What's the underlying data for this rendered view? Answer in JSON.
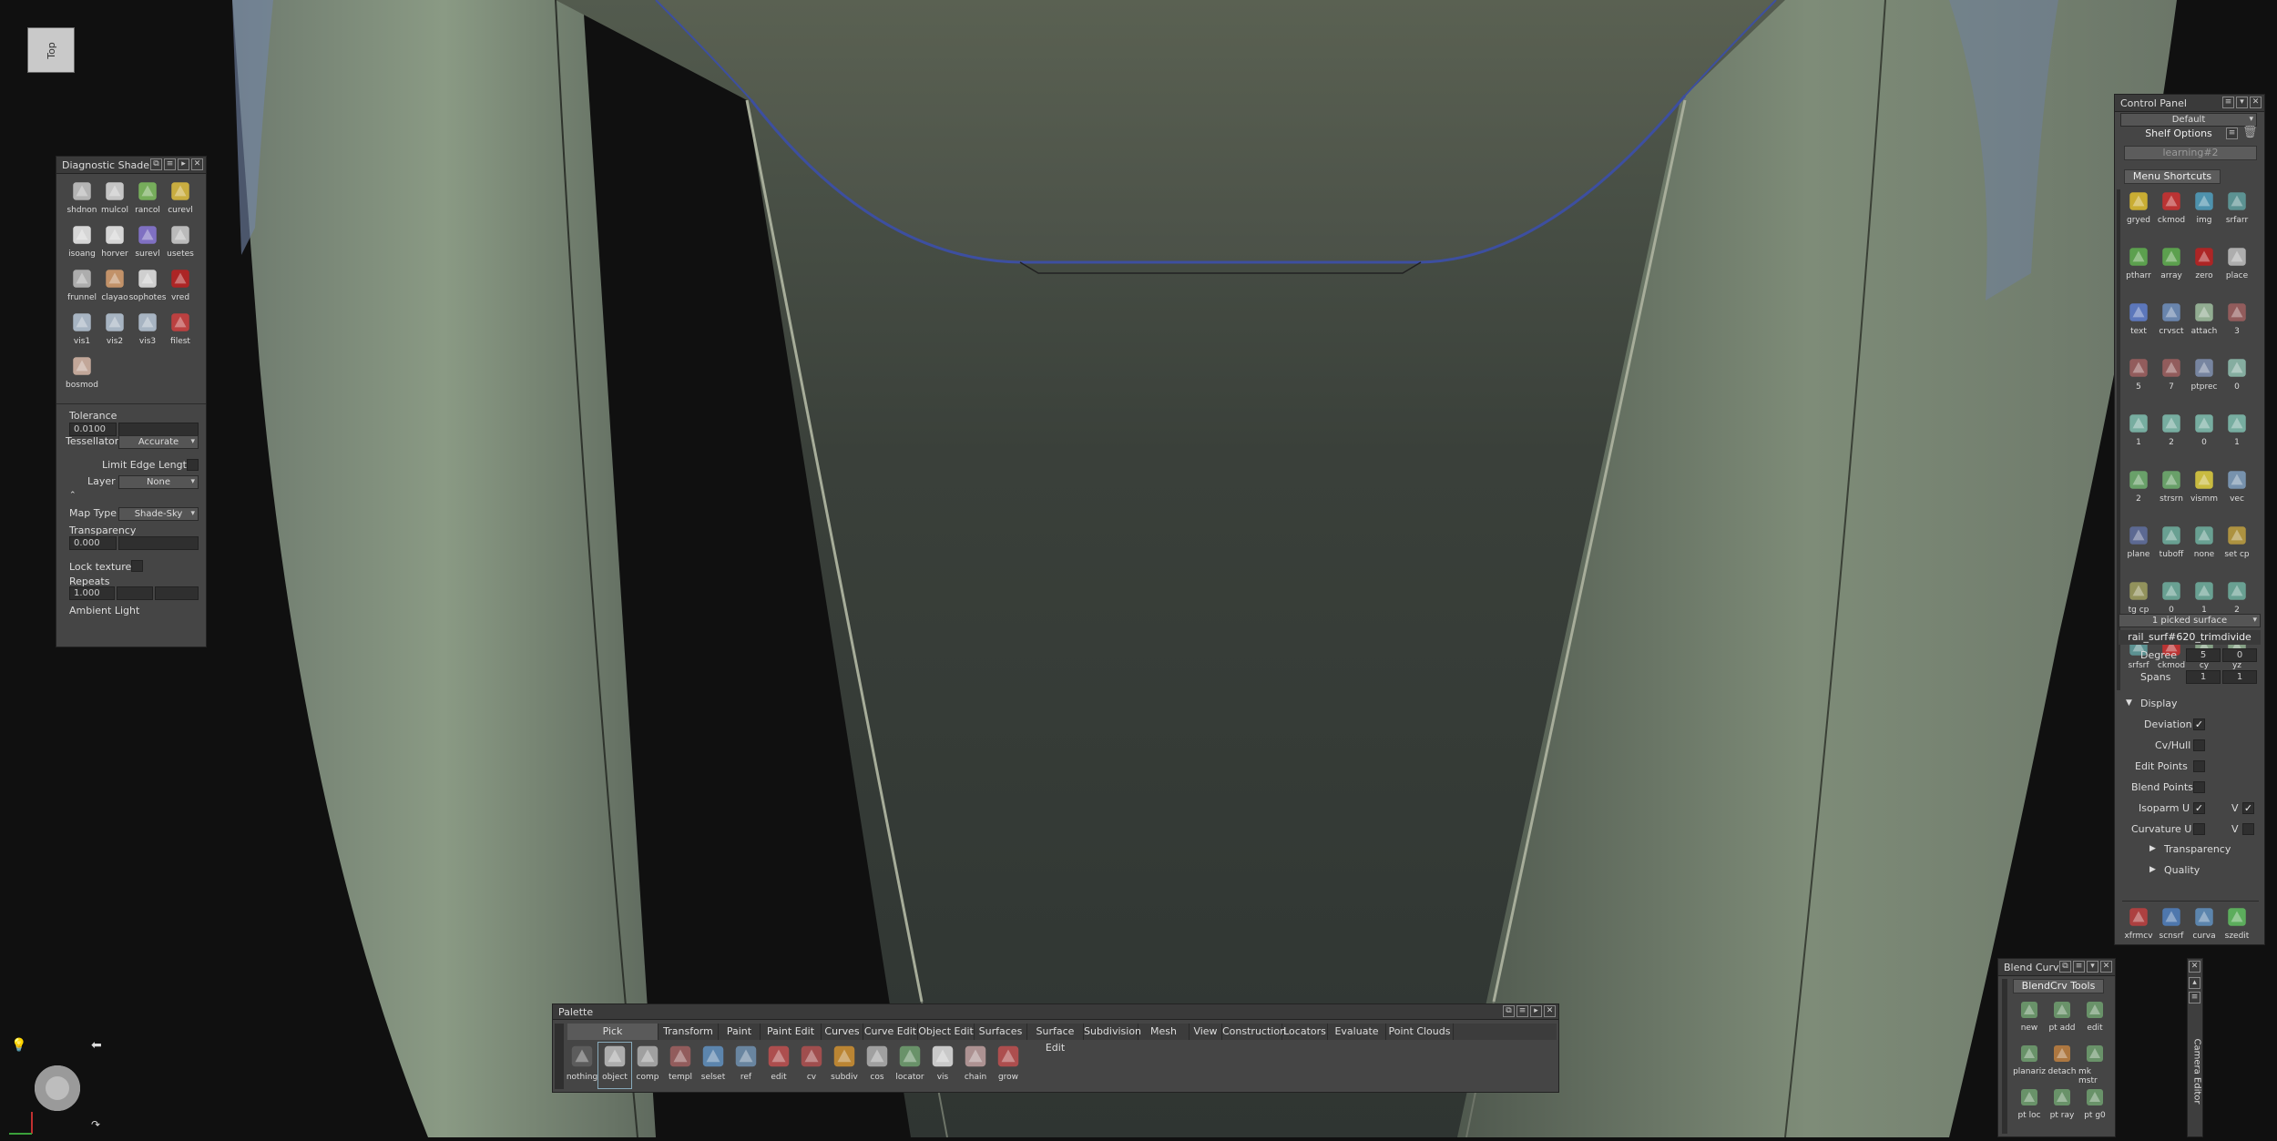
{
  "viewport": {
    "view_label": "Top"
  },
  "diagnostic_shade": {
    "title": "Diagnostic Shade",
    "tools": [
      {
        "label": "shdnon",
        "color": "#c8c8c8"
      },
      {
        "label": "mulcol",
        "color": "#dcdcdc"
      },
      {
        "label": "rancol",
        "color": "#7fbf5f"
      },
      {
        "label": "curevl",
        "color": "#e0c040"
      },
      {
        "label": "isoang",
        "color": "#f0f0f0"
      },
      {
        "label": "horver",
        "color": "#f0f0f0"
      },
      {
        "label": "surevl",
        "color": "#8a78d8"
      },
      {
        "label": "usetes",
        "color": "#cfcfcf"
      },
      {
        "label": "frunnel",
        "color": "#c0c0c0"
      },
      {
        "label": "clayao",
        "color": "#d8a070"
      },
      {
        "label": "sophotes",
        "color": "#e8e8e8"
      },
      {
        "label": "vred",
        "color": "#c02020"
      },
      {
        "label": "vis1",
        "color": "#b8c8d8"
      },
      {
        "label": "vis2",
        "color": "#b8c8d8"
      },
      {
        "label": "vis3",
        "color": "#b8c8d8"
      },
      {
        "label": "filest",
        "color": "#d04040"
      },
      {
        "label": "bosmod",
        "color": "#d8b8a8"
      }
    ],
    "tolerance_label": "Tolerance",
    "tolerance_value": "0.0100",
    "tessellator_label": "Tessellator",
    "tessellator_value": "Accurate",
    "limit_edge_label": "Limit Edge Length",
    "layer_label": "Layer",
    "layer_value": "None",
    "map_type_label": "Map Type",
    "map_type_value": "Shade-Sky",
    "transparency_label": "Transparency",
    "transparency_value": "0.000",
    "lock_texture_label": "Lock texture",
    "repeats_label": "Repeats",
    "repeats_value": "1.000",
    "ambient_label": "Ambient Light"
  },
  "control_panel": {
    "title": "Control Panel",
    "preset": "Default",
    "shelf_options": "Shelf Options",
    "shelf_name": "learning#2",
    "menu_shortcuts": "Menu Shortcuts",
    "shortcuts": [
      {
        "label": "gryed",
        "color": "#e0c030"
      },
      {
        "label": "ckmod",
        "color": "#d03030"
      },
      {
        "label": "img",
        "color": "#50a0c0"
      },
      {
        "label": "srfarr",
        "color": "#60a0a0"
      },
      {
        "label": "ptharr",
        "color": "#60b050"
      },
      {
        "label": "array",
        "color": "#60b050"
      },
      {
        "label": "zero",
        "color": "#c02020"
      },
      {
        "label": "place",
        "color": "#c0c0c0"
      },
      {
        "label": "text",
        "color": "#6080d0"
      },
      {
        "label": "crvsct",
        "color": "#7090c0"
      },
      {
        "label": "attach",
        "color": "#a0c0a0"
      },
      {
        "label": "3",
        "color": "#a06060"
      },
      {
        "label": "5",
        "color": "#a06060"
      },
      {
        "label": "7",
        "color": "#a06060"
      },
      {
        "label": "ptprec",
        "color": "#8090b0"
      },
      {
        "label": "0",
        "color": "#90c0b0"
      },
      {
        "label": "1",
        "color": "#80c0b0"
      },
      {
        "label": "2",
        "color": "#80c0b0"
      },
      {
        "label": "0",
        "color": "#80c0b0"
      },
      {
        "label": "1",
        "color": "#80c0b0"
      },
      {
        "label": "2",
        "color": "#70b070"
      },
      {
        "label": "strsrn",
        "color": "#70b070"
      },
      {
        "label": "vismm",
        "color": "#e0d040"
      },
      {
        "label": "vec",
        "color": "#80a0c0"
      },
      {
        "label": "plane",
        "color": "#6070a0"
      },
      {
        "label": "tuboff",
        "color": "#70b0a0"
      },
      {
        "label": "none",
        "color": "#70b0a0"
      },
      {
        "label": "set cp",
        "color": "#c0a040"
      },
      {
        "label": "tg cp",
        "color": "#a0a060"
      },
      {
        "label": "0",
        "color": "#70b0a0"
      },
      {
        "label": "1",
        "color": "#70b0a0"
      },
      {
        "label": "2",
        "color": "#70b0a0"
      },
      {
        "label": "srfsrf",
        "color": "#60a0a0"
      },
      {
        "label": "ckmod",
        "color": "#d03030"
      },
      {
        "label": "cy",
        "color": "#90b090"
      },
      {
        "label": "yz",
        "color": "#90b090"
      }
    ],
    "picked": "1 picked surface",
    "object_name": "rail_surf#620_trimdivide",
    "degree_label": "Degree",
    "degree_u": "5",
    "degree_v": "0",
    "spans_label": "Spans",
    "spans_u": "1",
    "spans_v": "1",
    "display_label": "Display",
    "deviation_label": "Deviation",
    "cvhull_label": "Cv/Hull",
    "edit_points_label": "Edit Points",
    "blend_points_label": "Blend Points",
    "isoparm_label": "Isoparm U",
    "curvature_label": "Curvature U",
    "v_label": "V",
    "transparency_label": "Transparency",
    "quality_label": "Quality",
    "bottom_tools": [
      {
        "label": "xfrmcv",
        "color": "#c04040"
      },
      {
        "label": "scnsrf",
        "color": "#5080c0"
      },
      {
        "label": "curva",
        "color": "#6090c0"
      },
      {
        "label": "szedit",
        "color": "#60c060"
      }
    ]
  },
  "blend_curve": {
    "title": "Blend Curve",
    "tools_header": "BlendCrv Tools",
    "tools": [
      {
        "label": "new",
        "color": "#70a070"
      },
      {
        "label": "pt add",
        "color": "#70a070"
      },
      {
        "label": "edit",
        "color": "#70a070"
      },
      {
        "label": "planariz",
        "color": "#70a070"
      },
      {
        "label": "detach",
        "color": "#c08040"
      },
      {
        "label": "mk mstr",
        "color": "#70a070"
      },
      {
        "label": "pt loc",
        "color": "#70a070"
      },
      {
        "label": "pt ray",
        "color": "#70a070"
      },
      {
        "label": "pt g0",
        "color": "#70a070"
      }
    ],
    "side_label": "Camera Editor"
  },
  "palette": {
    "title": "Palette",
    "tabs": [
      "Pick",
      "Transform",
      "Paint",
      "Paint Edit",
      "Curves",
      "Curve Edit",
      "Object Edit",
      "Surfaces",
      "Surface Edit",
      "Subdivision",
      "Mesh",
      "View",
      "Construction",
      "Locators",
      "Evaluate",
      "Point Clouds"
    ],
    "tools": [
      {
        "label": "nothing",
        "color": "#606060"
      },
      {
        "label": "object",
        "color": "#c0c0c0"
      },
      {
        "label": "comp",
        "color": "#b0b0b0"
      },
      {
        "label": "templ",
        "color": "#a06060"
      },
      {
        "label": "selset",
        "color": "#6090c0"
      },
      {
        "label": "ref",
        "color": "#7090b0"
      },
      {
        "label": "edit",
        "color": "#c05050"
      },
      {
        "label": "cv",
        "color": "#b05050"
      },
      {
        "label": "subdiv",
        "color": "#d09030"
      },
      {
        "label": "cos",
        "color": "#b0b0b0"
      },
      {
        "label": "locator",
        "color": "#70a070"
      },
      {
        "label": "vis",
        "color": "#e0e0e0"
      },
      {
        "label": "chain",
        "color": "#c0a0a0"
      },
      {
        "label": "grow",
        "color": "#c05050"
      }
    ]
  }
}
